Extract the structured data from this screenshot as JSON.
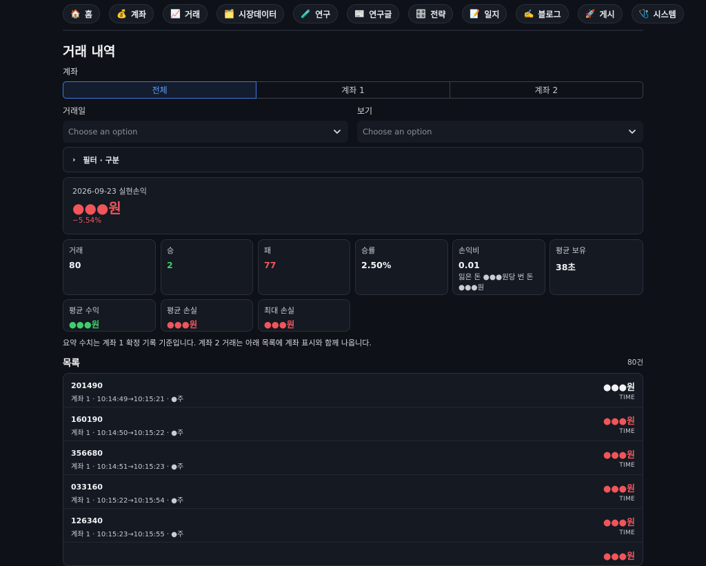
{
  "nav": [
    {
      "icon": "🏠",
      "label": "홈"
    },
    {
      "icon": "💰",
      "label": "계좌"
    },
    {
      "icon": "📈",
      "label": "거래"
    },
    {
      "icon": "🗂️",
      "label": "시장데이터"
    },
    {
      "icon": "🧪",
      "label": "연구"
    },
    {
      "icon": "📰",
      "label": "연구글"
    },
    {
      "icon": "🎛️",
      "label": "전략"
    },
    {
      "icon": "📝",
      "label": "일지"
    },
    {
      "icon": "✍️",
      "label": "블로그"
    },
    {
      "icon": "🚀",
      "label": "게시"
    },
    {
      "icon": "🩺",
      "label": "시스템"
    }
  ],
  "page": {
    "title": "거래 내역"
  },
  "account": {
    "label": "계좌",
    "options": [
      "전체",
      "계좌 1",
      "계좌 2"
    ],
    "selected": "전체"
  },
  "filters": {
    "date_label": "거래일",
    "date_placeholder": "Choose an option",
    "view_label": "보기",
    "view_placeholder": "Choose an option",
    "expander_label": "필터 · 구분"
  },
  "pnl": {
    "date_label": "2026-09-23 실현손익",
    "amount": "●●●원",
    "percent": "−5.54%"
  },
  "stats": {
    "trades": {
      "label": "거래",
      "value": "80"
    },
    "wins": {
      "label": "승",
      "value": "2"
    },
    "losses": {
      "label": "패",
      "value": "77"
    },
    "win_rate": {
      "label": "승률",
      "value": "2.50%"
    },
    "pl_ratio": {
      "label": "손익비",
      "value": "0.01",
      "sub": "잃은 돈 ●●●원당 번 돈 ●●●원"
    },
    "avg_hold": {
      "label": "평균 보유",
      "value": "38초"
    },
    "avg_gain": {
      "label": "평균 수익",
      "value": "●●●원"
    },
    "avg_loss": {
      "label": "평균 손실",
      "value": "●●●원"
    },
    "max_loss": {
      "label": "최대 손실",
      "value": "●●●원"
    }
  },
  "note": "요약 수치는 계좌 1 확정 기록 기준입니다. 계좌 2 거래는 아래 목록에 계좌 표시와 함께 나옵니다.",
  "list": {
    "title": "목록",
    "count": "80건",
    "rows": [
      {
        "code": "201490",
        "meta": "계좌 1 · 10:14:49→10:15:21 · ●주",
        "amount": "●●●원",
        "tag": "TIME",
        "color": "#f2f3f5"
      },
      {
        "code": "160190",
        "meta": "계좌 1 · 10:14:50→10:15:22 · ●주",
        "amount": "●●●원",
        "tag": "TIME",
        "color": "#f0555a"
      },
      {
        "code": "356680",
        "meta": "계좌 1 · 10:14:51→10:15:23 · ●주",
        "amount": "●●●원",
        "tag": "TIME",
        "color": "#f0555a"
      },
      {
        "code": "033160",
        "meta": "계좌 1 · 10:15:22→10:15:54 · ●주",
        "amount": "●●●원",
        "tag": "TIME",
        "color": "#f0555a"
      },
      {
        "code": "126340",
        "meta": "계좌 1 · 10:15:23→10:15:55 · ●주",
        "amount": "●●●원",
        "tag": "TIME",
        "color": "#f0555a"
      },
      {
        "code": "",
        "meta": "",
        "amount": "●●●원",
        "tag": "",
        "color": "#f0555a"
      }
    ]
  }
}
